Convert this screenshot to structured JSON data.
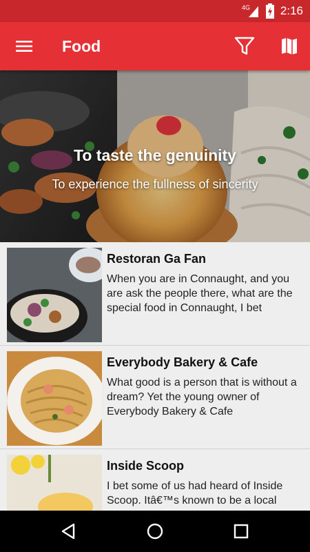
{
  "status_bar": {
    "network_label": "4G",
    "time": "2:16",
    "icons": [
      "signal-icon",
      "battery-charging-icon"
    ]
  },
  "app_bar": {
    "title": "Food",
    "icons": [
      "menu-icon",
      "filter-icon",
      "map-icon"
    ],
    "color": "#e53035"
  },
  "hero": {
    "title": "To taste the genuinity",
    "subtitle": "To experience the fullness of sincerity"
  },
  "list": {
    "items": [
      {
        "title": "Restoran Ga Fan",
        "description": "When you are in Connaught, and you are ask the people there, what are the special food in Connaught, I bet"
      },
      {
        "title": "Everybody Bakery & Cafe",
        "description": "What good is a person that is without a dream? Yet the young owner of Everybody Bakery & Cafe"
      },
      {
        "title": "Inside Scoop",
        "description": "I bet some of us had heard of Inside Scoop. Itâ€™s known to be a local"
      }
    ]
  },
  "nav_bar": {
    "icons": [
      "back-icon",
      "home-icon",
      "recent-apps-icon"
    ]
  }
}
